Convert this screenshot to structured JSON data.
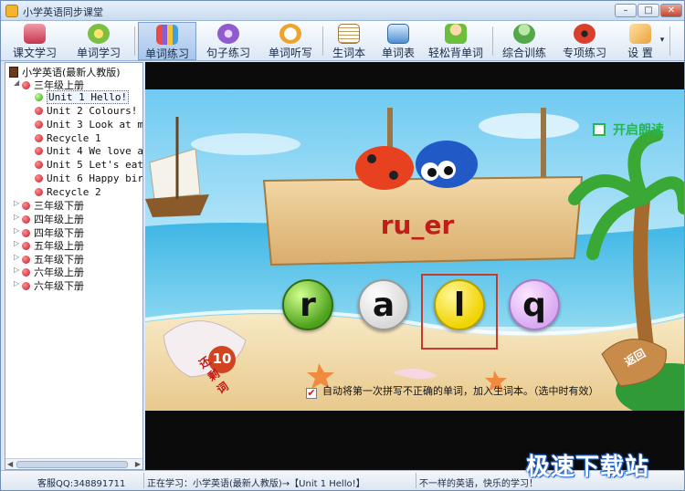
{
  "window": {
    "title": "小学英语同步课堂",
    "controls": [
      "–",
      "□",
      "✕"
    ]
  },
  "toolbar": {
    "items": [
      {
        "label": "课文学习",
        "icon": "books-icon",
        "color": "#d9455f"
      },
      {
        "label": "单词学习",
        "icon": "flower-icon",
        "color": "#7bc043"
      },
      {
        "label": "单词练习",
        "icon": "pencils-icon",
        "color": "#8a5cd1",
        "active": true
      },
      {
        "label": "句子练习",
        "icon": "headphones-icon",
        "color": "#8f5bcf"
      },
      {
        "label": "单词听写",
        "icon": "clock-icon",
        "color": "#f0a32b"
      },
      {
        "label": "生词本",
        "icon": "notepad-pencil-icon",
        "color": "#c89b5d"
      },
      {
        "label": "单词表",
        "icon": "book-search-icon",
        "color": "#4f8fd0"
      },
      {
        "label": "轻松背单词",
        "icon": "reading-icon",
        "color": "#6bbf3b"
      },
      {
        "label": "综合训练",
        "icon": "users-icon",
        "color": "#55a84a"
      },
      {
        "label": "专项练习",
        "icon": "ladybug-icon",
        "color": "#d8402b"
      },
      {
        "label": "设 置",
        "icon": "wrench-icon",
        "color": "#e9a33c"
      }
    ]
  },
  "tree": {
    "root": "小学英语(最新人教版)",
    "grades": [
      {
        "label": "三年级上册",
        "expanded": true,
        "units": [
          "Unit 1 Hello!",
          "Unit 2 Colours!",
          "Unit 3 Look at m",
          "Recycle 1",
          "Unit 4 We love a",
          "Unit 5 Let's eat",
          "Unit 6 Happy bir",
          "Recycle 2"
        ]
      },
      {
        "label": "三年级下册"
      },
      {
        "label": "四年级上册"
      },
      {
        "label": "四年级下册"
      },
      {
        "label": "五年级上册"
      },
      {
        "label": "五年级下册"
      },
      {
        "label": "六年级上册"
      },
      {
        "label": "六年级下册"
      }
    ],
    "selected": "Unit 1 Hello!"
  },
  "game": {
    "word": "ru_er",
    "letters": [
      "r",
      "a",
      "l",
      "q"
    ],
    "selected_letter": "l",
    "read_aloud_label": "开启朗读",
    "remaining_label": "还剩词",
    "remaining_count": "10",
    "auto_add_label": "自动将第一次拼写不正确的单词，加入生词本。（选中时有效）",
    "auto_add_checked": true,
    "back_label": "返回"
  },
  "status": {
    "support": "客服QQ:348891711",
    "current": "正在学习：小学英语(最新人教版)→【Unit 1 Hello!】",
    "slogan": "不一样的英语，快乐的学习！"
  },
  "watermark": "极速下载站"
}
